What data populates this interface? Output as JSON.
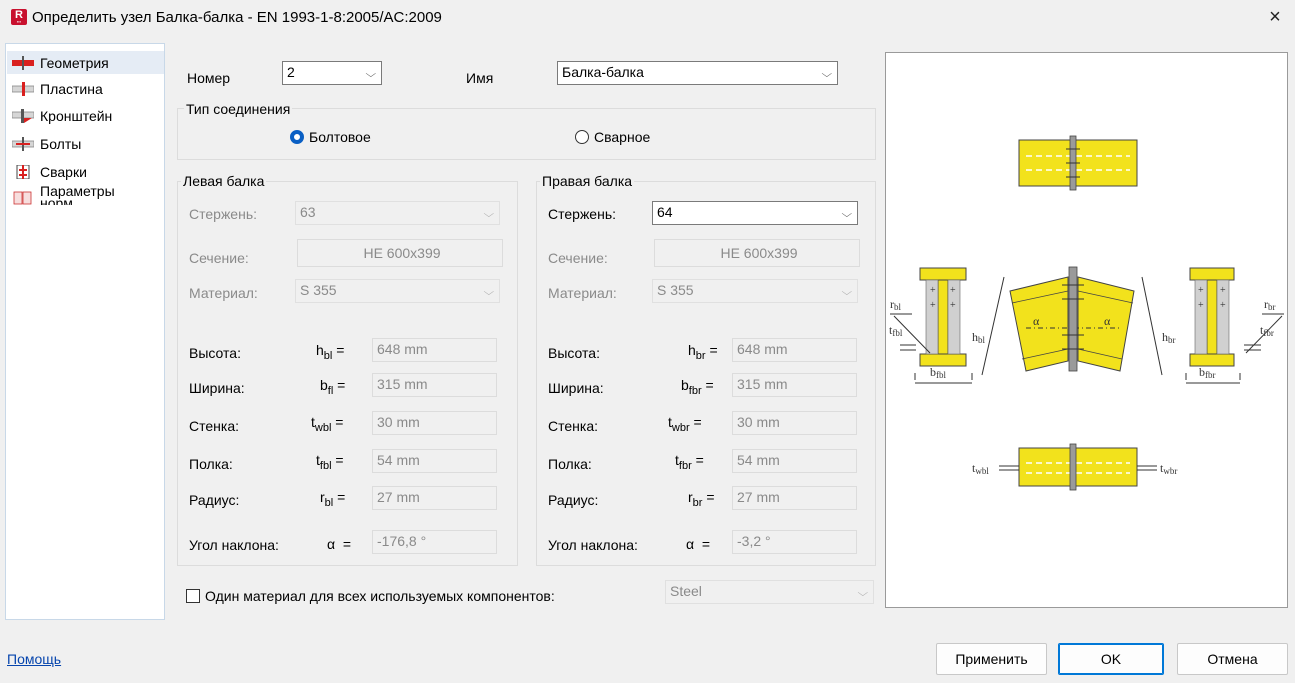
{
  "window": {
    "title": "Определить узел Балка-балка - EN 1993-1-8:2005/AC:2009",
    "close_label": "×"
  },
  "nav": {
    "items": [
      {
        "label": "Геометрия",
        "selected": true
      },
      {
        "label": "Пластина"
      },
      {
        "label": "Кронштейн"
      },
      {
        "label": "Болты"
      },
      {
        "label": "Сварки"
      },
      {
        "label": "Параметры норм"
      }
    ]
  },
  "header": {
    "number_label": "Номер",
    "number_value": "2",
    "name_label": "Имя",
    "name_value": "Балка-балка"
  },
  "connection_type": {
    "title": "Тип соединения",
    "bolted_label": "Болтовое",
    "bolted_selected": true,
    "welded_label": "Сварное",
    "welded_selected": false
  },
  "left_beam": {
    "title": "Левая балка",
    "member_label": "Стержень:",
    "member_value": "63",
    "section_label": "Сечение:",
    "section_value": "HE 600x399",
    "material_label": "Материал:",
    "material_value": "S 355",
    "height_label": "Высота:",
    "height_sym": "h",
    "height_sub": "bl",
    "height_value": "648 mm",
    "width_label": "Ширина:",
    "width_sym": "b",
    "width_sub": "fl",
    "width_value": "315 mm",
    "web_label": "Стенка:",
    "web_sym": "t",
    "web_sub": "wbl",
    "web_value": "30 mm",
    "flange_label": "Полка:",
    "flange_sym": "t",
    "flange_sub": "fbl",
    "flange_value": "54 mm",
    "radius_label": "Радиус:",
    "radius_sym": "r",
    "radius_sub": "bl",
    "radius_value": "27 mm",
    "angle_label": "Угол наклона:",
    "angle_sym": "α",
    "angle_value": "-176,8 °"
  },
  "right_beam": {
    "title": "Правая балка",
    "member_label": "Стержень:",
    "member_value": "64",
    "section_label": "Сечение:",
    "section_value": "HE 600x399",
    "material_label": "Материал:",
    "material_value": "S 355",
    "height_label": "Высота:",
    "height_sym": "h",
    "height_sub": "br",
    "height_value": "648 mm",
    "width_label": "Ширина:",
    "width_sym": "b",
    "width_sub": "fbr",
    "width_value": "315 mm",
    "web_label": "Стенка:",
    "web_sym": "t",
    "web_sub": "wbr",
    "web_value": "30 mm",
    "flange_label": "Полка:",
    "flange_sym": "t",
    "flange_sub": "fbr",
    "flange_value": "54 mm",
    "radius_label": "Радиус:",
    "radius_sym": "r",
    "radius_sub": "br",
    "radius_value": "27 mm",
    "angle_label": "Угол наклона:",
    "angle_sym": "α",
    "angle_value": "-3,2 °"
  },
  "shared_material": {
    "label": "Один материал для всех используемых компонентов:",
    "checked": false,
    "value": "Steel"
  },
  "preview": {
    "labels": {
      "rbl": "r",
      "rbl_sub": "bl",
      "tfbl": "t",
      "tfbl_sub": "fbl",
      "hbl": "h",
      "hbl_sub": "bl",
      "bfbl": "b",
      "bfbl_sub": "fbl",
      "hbr": "h",
      "hbr_sub": "br",
      "rbr": "r",
      "rbr_sub": "br",
      "tfbr": "t",
      "tfbr_sub": "fbr",
      "bfbr": "b",
      "bfbr_sub": "fbr",
      "twbl": "t",
      "twbl_sub": "wbl",
      "twbr": "t",
      "twbr_sub": "wbr",
      "alpha": "α"
    },
    "colors": {
      "steel": "#f2e21c",
      "outline": "#333333",
      "plate": "#9a9a9a"
    }
  },
  "footer": {
    "help_label": "Помощь",
    "apply_label": "Применить",
    "ok_label": "OK",
    "cancel_label": "Отмена"
  }
}
